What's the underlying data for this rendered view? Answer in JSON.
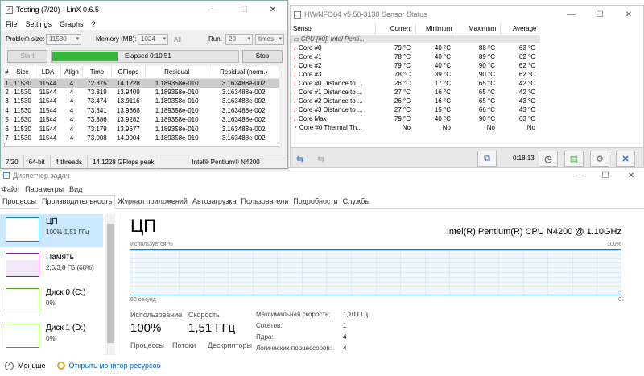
{
  "linx": {
    "title": "Testing (7/20) - LinX 0.6.5",
    "menu": [
      "File",
      "Settings",
      "Graphs",
      "?"
    ],
    "problem_size_label": "Problem size:",
    "problem_size_value": "11530",
    "memory_label": "Memory (MB):",
    "memory_value": "1024",
    "all_label": "All",
    "run_label": "Run:",
    "run_value": "20",
    "run_unit": "times",
    "start_label": "Start",
    "stop_label": "Stop",
    "elapsed": "Elapsed 0:10:51",
    "progress_fraction": 0.35,
    "columns": [
      "#",
      "Size",
      "LDA",
      "Align",
      "Time",
      "GFlops",
      "Residual",
      "Residual (norm.)"
    ],
    "rows": [
      [
        "1",
        "11530",
        "11544",
        "4",
        "72.375",
        "14.1228",
        "1.189358e-010",
        "3.163488e-002"
      ],
      [
        "2",
        "11530",
        "11544",
        "4",
        "73.319",
        "13.9409",
        "1.189358e-010",
        "3.163488e-002"
      ],
      [
        "3",
        "11530",
        "11544",
        "4",
        "73.474",
        "13.9116",
        "1.189358e-010",
        "3.163488e-002"
      ],
      [
        "4",
        "11530",
        "11544",
        "4",
        "73.341",
        "13.9368",
        "1.189358e-010",
        "3.163488e-002"
      ],
      [
        "5",
        "11530",
        "11544",
        "4",
        "73.386",
        "13.9282",
        "1.189358e-010",
        "3.163488e-002"
      ],
      [
        "6",
        "11530",
        "11544",
        "4",
        "73.179",
        "13.9677",
        "1.189358e-010",
        "3.163488e-002"
      ],
      [
        "7",
        "11530",
        "11544",
        "4",
        "73.008",
        "14.0004",
        "1.189358e-010",
        "3.163488e-002"
      ]
    ],
    "status": [
      "7/20",
      "64-bit",
      "4 threads",
      "14.1228 GFlops peak",
      "Intel® Pentium® N4200"
    ]
  },
  "hwinfo": {
    "title": "HWiNFO64 v5.50-3130 Sensor Status",
    "columns": [
      "Sensor",
      "Current",
      "Minimum",
      "Maximum",
      "Average"
    ],
    "group": "CPU [#0]: Intel Penti...",
    "rows": [
      [
        "Core #0",
        "79 °C",
        "40 °C",
        "88 °C",
        "63 °C"
      ],
      [
        "Core #1",
        "78 °C",
        "40 °C",
        "89 °C",
        "62 °C"
      ],
      [
        "Core #2",
        "79 °C",
        "40 °C",
        "90 °C",
        "62 °C"
      ],
      [
        "Core #3",
        "78 °C",
        "39 °C",
        "90 °C",
        "62 °C"
      ],
      [
        "Core #0 Distance to ...",
        "26 °C",
        "17 °C",
        "65 °C",
        "42 °C"
      ],
      [
        "Core #1 Distance to ...",
        "27 °C",
        "16 °C",
        "65 °C",
        "42 °C"
      ],
      [
        "Core #2 Distance to ...",
        "26 °C",
        "16 °C",
        "65 °C",
        "43 °C"
      ],
      [
        "Core #3 Distance to ...",
        "27 °C",
        "15 °C",
        "66 °C",
        "43 °C"
      ],
      [
        "Core Max",
        "79 °C",
        "40 °C",
        "90 °C",
        "63 °C"
      ],
      [
        "Core #0 Thermal Th...",
        "No",
        "No",
        "No",
        "No"
      ]
    ],
    "elapsed": "0:18:13"
  },
  "taskmgr": {
    "title": "Диспетчер задач",
    "menu": [
      "Файл",
      "Параметры",
      "Вид"
    ],
    "tabs": [
      "Процессы",
      "Производительность",
      "Журнал приложений",
      "Автозагрузка",
      "Пользователи",
      "Подробности",
      "Службы"
    ],
    "side": [
      {
        "title": "ЦП",
        "sub": "100% 1,51 ГГц",
        "color": "#117dbb"
      },
      {
        "title": "Память",
        "sub": "2,6/3,8 ГБ (68%)",
        "color": "#8b12ae"
      },
      {
        "title": "Диск 0 (C:)",
        "sub": "0%",
        "color": "#4da60c"
      },
      {
        "title": "Диск 1 (D:)",
        "sub": "0%",
        "color": "#4da60c"
      }
    ],
    "cpu_title": "ЦП",
    "cpu_model": "Intel(R) Pentium(R) CPU N4200 @ 1.10GHz",
    "graph_label": "Используется %",
    "graph_max": "100%",
    "graph_time": "60 секунд",
    "graph_min": "0",
    "usage_label": "Использование",
    "usage_value": "100%",
    "speed_label": "Скорость",
    "speed_value": "1,51 ГГц",
    "processes_label": "Процессы",
    "threads_label": "Потоки",
    "handles_label": "Дескрипторы",
    "max_speed_label": "Максимальная скорость:",
    "max_speed_value": "1,10 ГГц",
    "sockets_label": "Сокетов:",
    "sockets_value": "1",
    "cores_label": "Ядра:",
    "cores_value": "4",
    "lp_label": "Логических процессоров:",
    "lp_value": "4",
    "less_label": "Меньше",
    "monitor_label": "Открыть монитор ресурсов"
  }
}
